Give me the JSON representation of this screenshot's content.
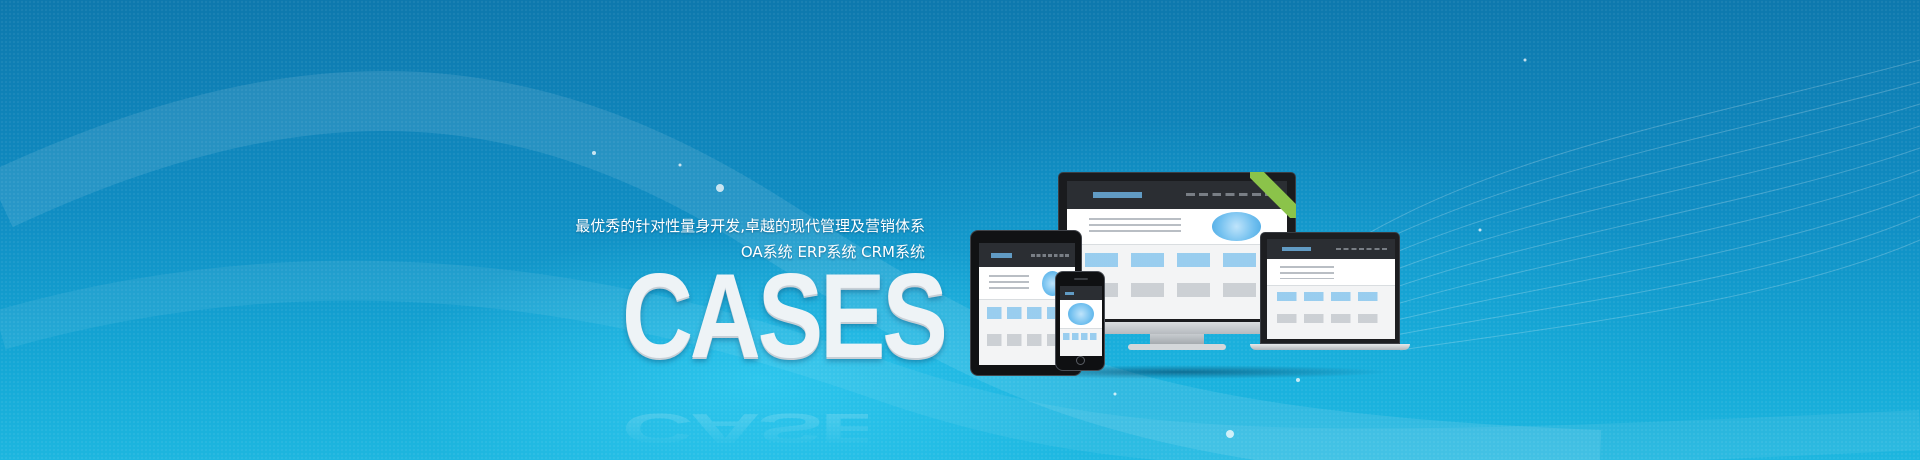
{
  "banner": {
    "tagline_line1": "最优秀的针对性量身开发,卓越的现代管理及营销体系",
    "tagline_line2": "OA系统 ERP系统 CRM系统",
    "heading": "CASES"
  },
  "devices": [
    "monitor",
    "laptop",
    "tablet",
    "phone"
  ],
  "colors": {
    "background_top": "#0d78ad",
    "background_bottom": "#1db6df",
    "heading": "#eef3f6",
    "ribbon": "#8bc34a"
  }
}
